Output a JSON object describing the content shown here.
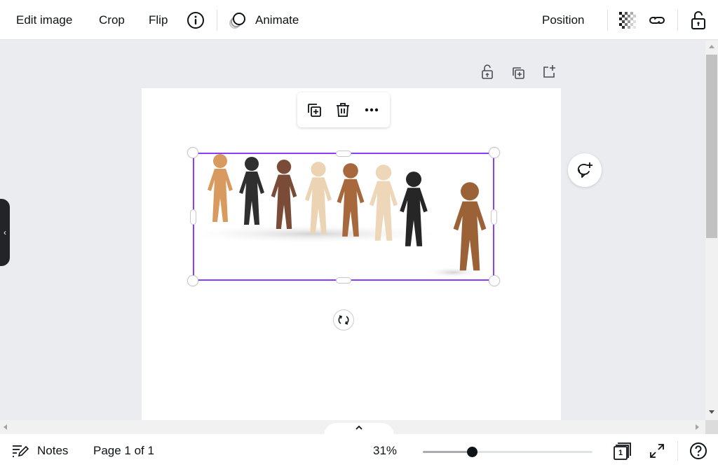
{
  "toolbar": {
    "edit_image": "Edit image",
    "crop": "Crop",
    "flip": "Flip",
    "info_icon": "info-icon",
    "animate": "Animate",
    "position": "Position",
    "transparency_icon": "transparency-icon",
    "link_icon": "link-icon",
    "lock_icon": "unlocked-icon"
  },
  "page_tools": {
    "lock_icon": "unlocked-icon",
    "duplicate_icon": "duplicate-page-icon",
    "add_page_icon": "add-page-icon"
  },
  "context_toolbar": {
    "duplicate_icon": "duplicate-icon",
    "delete_icon": "trash-icon",
    "more_icon": "more-icon"
  },
  "canvas": {
    "image_description": "Row of paper cut-out people figures in various skin tones holding hands, one figure standing apart",
    "figure_colors": [
      "#d99a5f",
      "#2f2f2f",
      "#7a4b36",
      "#ecd3b4",
      "#a8683e",
      "#eed7b8",
      "#262626",
      "#9b6238"
    ],
    "selection_color": "#8b3dff"
  },
  "footer": {
    "notes": "Notes",
    "page_indicator": "Page 1 of 1",
    "zoom": "31%",
    "zoom_fraction": 0.29,
    "page_count_badge": "1"
  }
}
